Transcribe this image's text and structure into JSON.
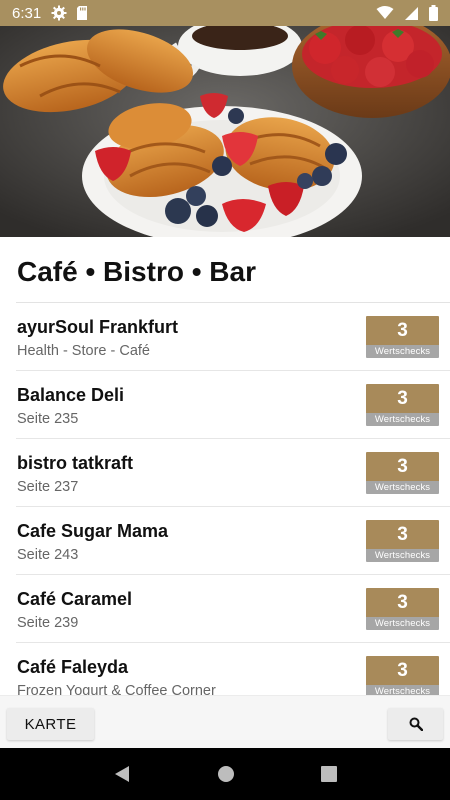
{
  "status_bar": {
    "time": "6:31",
    "icons_left": [
      "gear-icon",
      "sd-card-icon"
    ],
    "icons_right": [
      "wifi-icon",
      "signal-icon",
      "battery-icon"
    ],
    "background": "#a89060"
  },
  "hero_image": {
    "subject": "croissants-strawberries-breakfast-photo"
  },
  "section": {
    "title": "Café • Bistro • Bar"
  },
  "entries": [
    {
      "name": "ayurSoul Frankfurt",
      "subtitle": "Health - Store - Café",
      "count": "3",
      "count_label": "Wertschecks"
    },
    {
      "name": "Balance Deli",
      "subtitle": "Seite 235",
      "count": "3",
      "count_label": "Wertschecks"
    },
    {
      "name": "bistro tatkraft",
      "subtitle": "Seite 237",
      "count": "3",
      "count_label": "Wertschecks"
    },
    {
      "name": "Cafe Sugar Mama",
      "subtitle": "Seite 243",
      "count": "3",
      "count_label": "Wertschecks"
    },
    {
      "name": "Café Caramel",
      "subtitle": "Seite 239",
      "count": "3",
      "count_label": "Wertschecks"
    },
    {
      "name": "Café Faleyda",
      "subtitle": "Frozen Yogurt & Coffee Corner",
      "count": "3",
      "count_label": "Wertschecks"
    }
  ],
  "bottom_bar": {
    "map_button_label": "KARTE",
    "search_icon": "search-icon"
  },
  "nav_bar": {
    "icons": [
      "back-icon",
      "home-icon",
      "recents-icon"
    ]
  },
  "colors": {
    "badge_gold": "#a88a5a",
    "badge_gray": "#a6a6a6",
    "accent": "#a89060"
  }
}
